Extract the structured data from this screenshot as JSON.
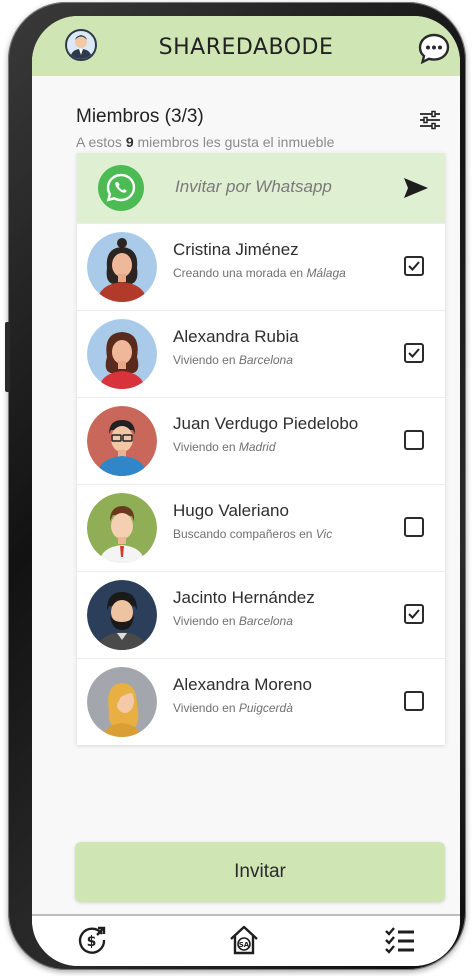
{
  "header": {
    "title": "SHAREDABODE",
    "avatar_icon": "user-avatar-icon",
    "chat_icon": "chat-bubble-icon"
  },
  "members": {
    "title": "Miembros (3/3)",
    "subtitle_prefix": "A estos ",
    "subtitle_count": "9",
    "subtitle_suffix": " miembros les gusta el inmueble",
    "filter_icon": "filter-sliders-icon"
  },
  "whatsapp": {
    "label": "Invitar por Whatsapp",
    "icon": "whatsapp-icon",
    "send_icon": "send-icon"
  },
  "list": [
    {
      "name": "Cristina Jiménez",
      "detail_prefix": "Creando una morada en ",
      "place": "Málaga",
      "checked": true
    },
    {
      "name": "Alexandra Rubia",
      "detail_prefix": "Viviendo en ",
      "place": "Barcelona",
      "checked": true
    },
    {
      "name": "Juan Verdugo Piedelobo",
      "detail_prefix": "Viviendo en ",
      "place": "Madrid",
      "checked": false
    },
    {
      "name": "Hugo Valeriano",
      "detail_prefix": "Buscando compañeros en ",
      "place": "Vic",
      "checked": false
    },
    {
      "name": "Jacinto Hernández",
      "detail_prefix": "Viviendo en ",
      "place": "Barcelona",
      "checked": true
    },
    {
      "name": "Alexandra Moreno",
      "detail_prefix": "Viviendo en ",
      "place": "Puigcerdà",
      "checked": false
    }
  ],
  "invite_button": {
    "label": "Invitar"
  },
  "bottom_nav": {
    "left_icon": "money-exchange-icon",
    "center_icon": "home-sa-icon",
    "center_text": "SA",
    "right_icon": "checklist-icon"
  },
  "colors": {
    "accent_green": "#cfe6b4",
    "whatsapp_row": "#deefd2",
    "whatsapp_brand": "#4cbb53"
  }
}
